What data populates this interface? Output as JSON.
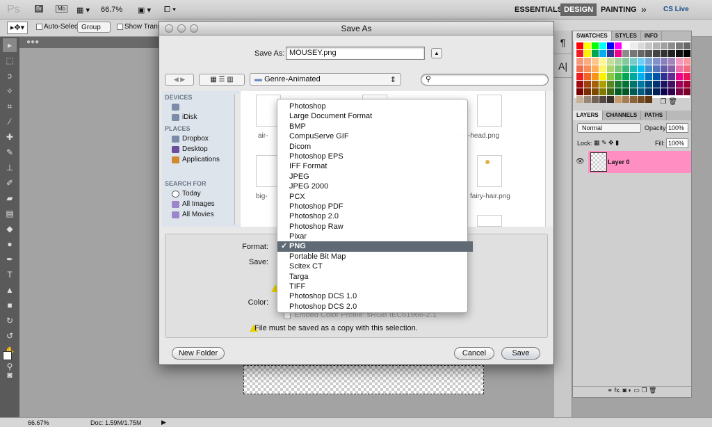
{
  "appbar": {
    "logo": "Ps",
    "br": "Br",
    "mb": "Mb",
    "zoom": "66.7%",
    "workspaces": [
      "ESSENTIALS",
      "DESIGN",
      "PAINTING"
    ],
    "active_workspace": "DESIGN",
    "more": "»",
    "cslive": "CS Live"
  },
  "options": {
    "auto_select": "Auto-Select:",
    "group": "Group",
    "show_transform": "Show Transfor"
  },
  "dialog": {
    "title": "Save As",
    "save_as_label": "Save As:",
    "filename": "MOUSEY.png",
    "folder": "Genre-Animated",
    "sidebar": {
      "devices": "DEVICES",
      "device_items": [
        "",
        "iDisk"
      ],
      "places": "PLACES",
      "place_items": [
        "Dropbox",
        "Desktop",
        "Applications"
      ],
      "search": "SEARCH FOR",
      "search_items": [
        "Today",
        "All Images",
        "All Movies"
      ]
    },
    "files": [
      "air-",
      "arrow-head.png",
      "big-",
      "fairy-hair.png"
    ],
    "format_label": "Format:",
    "save_label": "Save:",
    "color_label": "Color:",
    "embed": "Embed Color Profile:  sRGB IEC61966-2.1",
    "warning": "File must be saved as a copy with this selection.",
    "new_folder": "New Folder",
    "cancel": "Cancel",
    "save": "Save"
  },
  "format_menu": {
    "items": [
      "Photoshop",
      "Large Document Format",
      "BMP",
      "CompuServe GIF",
      "Dicom",
      "Photoshop EPS",
      "IFF Format",
      "JPEG",
      "JPEG 2000",
      "PCX",
      "Photoshop PDF",
      "Photoshop 2.0",
      "Photoshop Raw",
      "Pixar",
      "PNG",
      "Portable Bit Map",
      "Scitex CT",
      "Targa",
      "TIFF",
      "Photoshop DCS 1.0",
      "Photoshop DCS 2.0"
    ],
    "selected": "PNG",
    "check": "✓"
  },
  "panels": {
    "tabs1": [
      "SWATCHES",
      "STYLES",
      "INFO"
    ],
    "tabs2": [
      "LAYERS",
      "CHANNELS",
      "PATHS"
    ],
    "blend": "Normal",
    "opacity_label": "Opacity:",
    "opacity": "100%",
    "lock_label": "Lock:",
    "fill_label": "Fill:",
    "fill": "100%",
    "layer": "Layer 0",
    "layer_color": "#ff8fc3",
    "swatch_rows": [
      [
        "#ff0000",
        "#ffff00",
        "#00ff00",
        "#00ffff",
        "#0000ff",
        "#ff00ff",
        "#ffffff",
        "#ececec",
        "#d9d9d9",
        "#c6c6c6",
        "#b3b3b3",
        "#a0a0a0",
        "#8d8d8d",
        "#7a7a7a",
        "#676767"
      ],
      [
        "#ee1c24",
        "#fff200",
        "#00a651",
        "#00aeef",
        "#2e3192",
        "#ec008c",
        "#8c8c8c",
        "#777",
        "#666",
        "#555",
        "#444",
        "#333",
        "#222",
        "#111",
        "#000"
      ],
      [
        "#f7977a",
        "#f9ad81",
        "#fdc68a",
        "#fff79a",
        "#c4df9b",
        "#a3d39c",
        "#82ca9d",
        "#7accc8",
        "#6dcff6",
        "#7da7d9",
        "#8393ca",
        "#8781bd",
        "#a186be",
        "#f49ac2",
        "#f6989d"
      ],
      [
        "#f26c4f",
        "#f68e56",
        "#fbaf5d",
        "#fff568",
        "#acd372",
        "#7cc576",
        "#3bb878",
        "#1abbb4",
        "#00bff3",
        "#438ccb",
        "#5574b9",
        "#605ca8",
        "#855fa8",
        "#f06ea9",
        "#f26d7d"
      ],
      [
        "#ed1c24",
        "#f26522",
        "#f7941d",
        "#fff200",
        "#8dc63f",
        "#39b54a",
        "#00a651",
        "#00a99d",
        "#00aeef",
        "#0072bc",
        "#0054a6",
        "#2e3192",
        "#662d91",
        "#ec008c",
        "#ed145b"
      ],
      [
        "#9e0b0f",
        "#a0410d",
        "#a3620a",
        "#aba000",
        "#598527",
        "#1a7b30",
        "#007236",
        "#00746b",
        "#0076a3",
        "#004b80",
        "#003471",
        "#1b1464",
        "#440e62",
        "#9e005d",
        "#9e0039"
      ],
      [
        "#790000",
        "#7b2e00",
        "#7d4900",
        "#827b00",
        "#406618",
        "#005e20",
        "#005826",
        "#005952",
        "#005b7f",
        "#003663",
        "#002157",
        "#0d004c",
        "#32004b",
        "#7b0046",
        "#7a0026"
      ],
      [
        "#c7b299",
        "#998675",
        "#736357",
        "#534741",
        "#37302d",
        "#c69c6d",
        "#a67c52",
        "#8c6239",
        "#754c24",
        "#603913"
      ]
    ]
  },
  "status": {
    "zoom": "66.67%",
    "doc": "Doc: 1.59M/1.75M"
  }
}
